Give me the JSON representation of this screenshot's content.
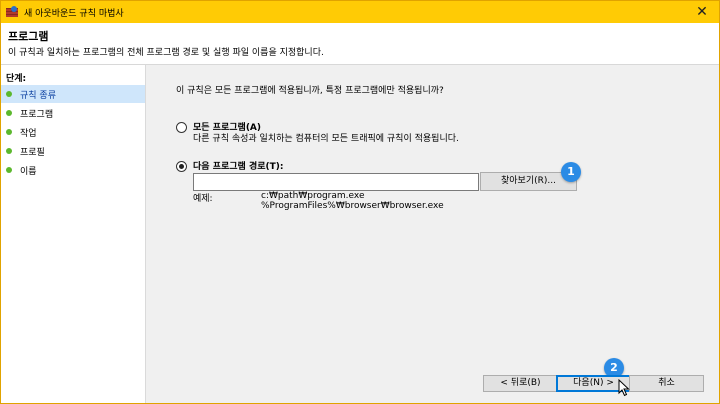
{
  "window": {
    "title": "새 아웃바운드 규칙 마법사",
    "icon": "firewall-icon",
    "close_glyph": "✕"
  },
  "header": {
    "title": "프로그램",
    "description": "이 규칙과 일치하는 프로그램의 전체 프로그램 경로 및 실행 파일 이름을 지정합니다."
  },
  "sidebar": {
    "label": "단계:",
    "items": [
      {
        "label": "규칙 종류",
        "active": true
      },
      {
        "label": "프로그램",
        "active": false
      },
      {
        "label": "작업",
        "active": false
      },
      {
        "label": "프로필",
        "active": false
      },
      {
        "label": "이름",
        "active": false
      }
    ]
  },
  "main": {
    "question": "이 규칙은 모든 프로그램에 적용됩니까, 특정 프로그램에만 적용됩니까?",
    "option_all": {
      "label": "모든 프로그램(A)",
      "desc": "다른 규칙 속성과 일치하는 컴퓨터의 모든 트래픽에 규칙이 적용됩니다.",
      "selected": false
    },
    "option_path": {
      "label": "다음 프로그램 경로(T):",
      "selected": true,
      "value": ""
    },
    "browse_label": "찾아보기(R)...",
    "example_label": "예제:",
    "example_lines": [
      "c:₩path₩program.exe",
      "%ProgramFiles%₩browser₩browser.exe"
    ]
  },
  "annotations": [
    "1",
    "2"
  ],
  "footer": {
    "back": "< 뒤로(B)",
    "next": "다음(N) >",
    "cancel": "취소"
  }
}
